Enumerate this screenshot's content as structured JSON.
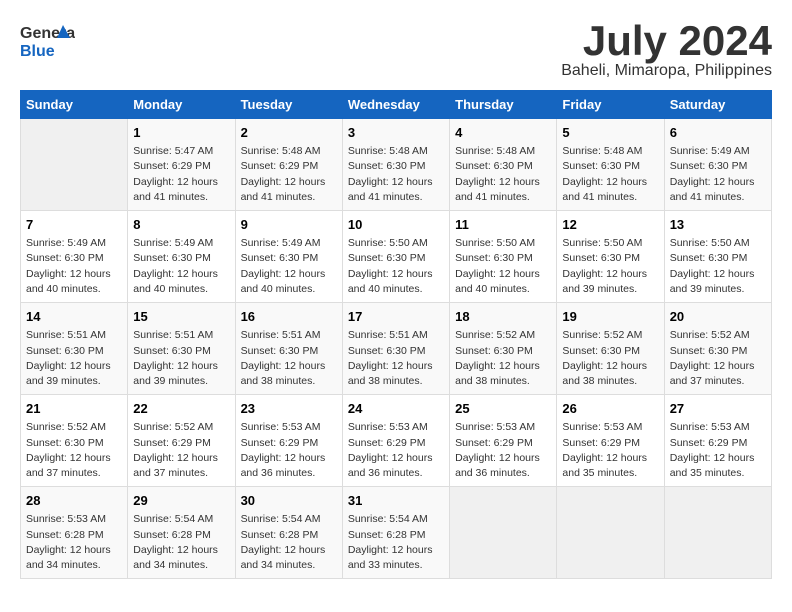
{
  "header": {
    "logo_general": "General",
    "logo_blue": "Blue",
    "month": "July 2024",
    "location": "Baheli, Mimaropa, Philippines"
  },
  "days_of_week": [
    "Sunday",
    "Monday",
    "Tuesday",
    "Wednesday",
    "Thursday",
    "Friday",
    "Saturday"
  ],
  "weeks": [
    [
      {
        "day": "",
        "info": ""
      },
      {
        "day": "1",
        "info": "Sunrise: 5:47 AM\nSunset: 6:29 PM\nDaylight: 12 hours\nand 41 minutes."
      },
      {
        "day": "2",
        "info": "Sunrise: 5:48 AM\nSunset: 6:29 PM\nDaylight: 12 hours\nand 41 minutes."
      },
      {
        "day": "3",
        "info": "Sunrise: 5:48 AM\nSunset: 6:30 PM\nDaylight: 12 hours\nand 41 minutes."
      },
      {
        "day": "4",
        "info": "Sunrise: 5:48 AM\nSunset: 6:30 PM\nDaylight: 12 hours\nand 41 minutes."
      },
      {
        "day": "5",
        "info": "Sunrise: 5:48 AM\nSunset: 6:30 PM\nDaylight: 12 hours\nand 41 minutes."
      },
      {
        "day": "6",
        "info": "Sunrise: 5:49 AM\nSunset: 6:30 PM\nDaylight: 12 hours\nand 41 minutes."
      }
    ],
    [
      {
        "day": "7",
        "info": "Sunrise: 5:49 AM\nSunset: 6:30 PM\nDaylight: 12 hours\nand 40 minutes."
      },
      {
        "day": "8",
        "info": "Sunrise: 5:49 AM\nSunset: 6:30 PM\nDaylight: 12 hours\nand 40 minutes."
      },
      {
        "day": "9",
        "info": "Sunrise: 5:49 AM\nSunset: 6:30 PM\nDaylight: 12 hours\nand 40 minutes."
      },
      {
        "day": "10",
        "info": "Sunrise: 5:50 AM\nSunset: 6:30 PM\nDaylight: 12 hours\nand 40 minutes."
      },
      {
        "day": "11",
        "info": "Sunrise: 5:50 AM\nSunset: 6:30 PM\nDaylight: 12 hours\nand 40 minutes."
      },
      {
        "day": "12",
        "info": "Sunrise: 5:50 AM\nSunset: 6:30 PM\nDaylight: 12 hours\nand 39 minutes."
      },
      {
        "day": "13",
        "info": "Sunrise: 5:50 AM\nSunset: 6:30 PM\nDaylight: 12 hours\nand 39 minutes."
      }
    ],
    [
      {
        "day": "14",
        "info": "Sunrise: 5:51 AM\nSunset: 6:30 PM\nDaylight: 12 hours\nand 39 minutes."
      },
      {
        "day": "15",
        "info": "Sunrise: 5:51 AM\nSunset: 6:30 PM\nDaylight: 12 hours\nand 39 minutes."
      },
      {
        "day": "16",
        "info": "Sunrise: 5:51 AM\nSunset: 6:30 PM\nDaylight: 12 hours\nand 38 minutes."
      },
      {
        "day": "17",
        "info": "Sunrise: 5:51 AM\nSunset: 6:30 PM\nDaylight: 12 hours\nand 38 minutes."
      },
      {
        "day": "18",
        "info": "Sunrise: 5:52 AM\nSunset: 6:30 PM\nDaylight: 12 hours\nand 38 minutes."
      },
      {
        "day": "19",
        "info": "Sunrise: 5:52 AM\nSunset: 6:30 PM\nDaylight: 12 hours\nand 38 minutes."
      },
      {
        "day": "20",
        "info": "Sunrise: 5:52 AM\nSunset: 6:30 PM\nDaylight: 12 hours\nand 37 minutes."
      }
    ],
    [
      {
        "day": "21",
        "info": "Sunrise: 5:52 AM\nSunset: 6:30 PM\nDaylight: 12 hours\nand 37 minutes."
      },
      {
        "day": "22",
        "info": "Sunrise: 5:52 AM\nSunset: 6:29 PM\nDaylight: 12 hours\nand 37 minutes."
      },
      {
        "day": "23",
        "info": "Sunrise: 5:53 AM\nSunset: 6:29 PM\nDaylight: 12 hours\nand 36 minutes."
      },
      {
        "day": "24",
        "info": "Sunrise: 5:53 AM\nSunset: 6:29 PM\nDaylight: 12 hours\nand 36 minutes."
      },
      {
        "day": "25",
        "info": "Sunrise: 5:53 AM\nSunset: 6:29 PM\nDaylight: 12 hours\nand 36 minutes."
      },
      {
        "day": "26",
        "info": "Sunrise: 5:53 AM\nSunset: 6:29 PM\nDaylight: 12 hours\nand 35 minutes."
      },
      {
        "day": "27",
        "info": "Sunrise: 5:53 AM\nSunset: 6:29 PM\nDaylight: 12 hours\nand 35 minutes."
      }
    ],
    [
      {
        "day": "28",
        "info": "Sunrise: 5:53 AM\nSunset: 6:28 PM\nDaylight: 12 hours\nand 34 minutes."
      },
      {
        "day": "29",
        "info": "Sunrise: 5:54 AM\nSunset: 6:28 PM\nDaylight: 12 hours\nand 34 minutes."
      },
      {
        "day": "30",
        "info": "Sunrise: 5:54 AM\nSunset: 6:28 PM\nDaylight: 12 hours\nand 34 minutes."
      },
      {
        "day": "31",
        "info": "Sunrise: 5:54 AM\nSunset: 6:28 PM\nDaylight: 12 hours\nand 33 minutes."
      },
      {
        "day": "",
        "info": ""
      },
      {
        "day": "",
        "info": ""
      },
      {
        "day": "",
        "info": ""
      }
    ]
  ]
}
